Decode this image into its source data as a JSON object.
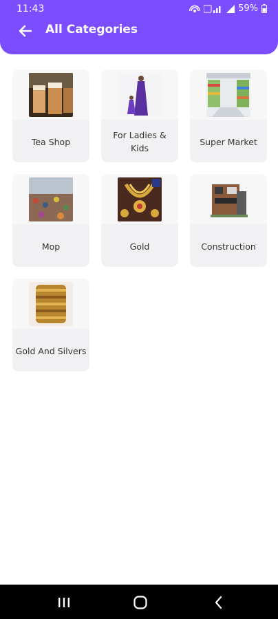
{
  "status_bar": {
    "time": "11:43",
    "battery": "59%"
  },
  "app_bar": {
    "title": "All Categories",
    "background_color": "#7c4dff",
    "back_icon": "arrow-left-icon"
  },
  "categories": [
    {
      "label": "Tea Shop",
      "image": "tea-glasses-photo"
    },
    {
      "label": "For Ladies & Kids",
      "image": "purple-dress-photo"
    },
    {
      "label": "Super Market",
      "image": "supermarket-aisle-photo"
    },
    {
      "label": "Mop",
      "image": "market-crowd-photo"
    },
    {
      "label": "Gold",
      "image": "gold-jewellery-photo"
    },
    {
      "label": "Construction",
      "image": "building-render-photo"
    },
    {
      "label": "Gold And Silvers",
      "image": "gold-bangles-photo"
    }
  ],
  "nav_bar": {
    "recent_icon": "recent-apps-icon",
    "home_icon": "home-icon",
    "back_icon": "back-chevron-icon"
  }
}
